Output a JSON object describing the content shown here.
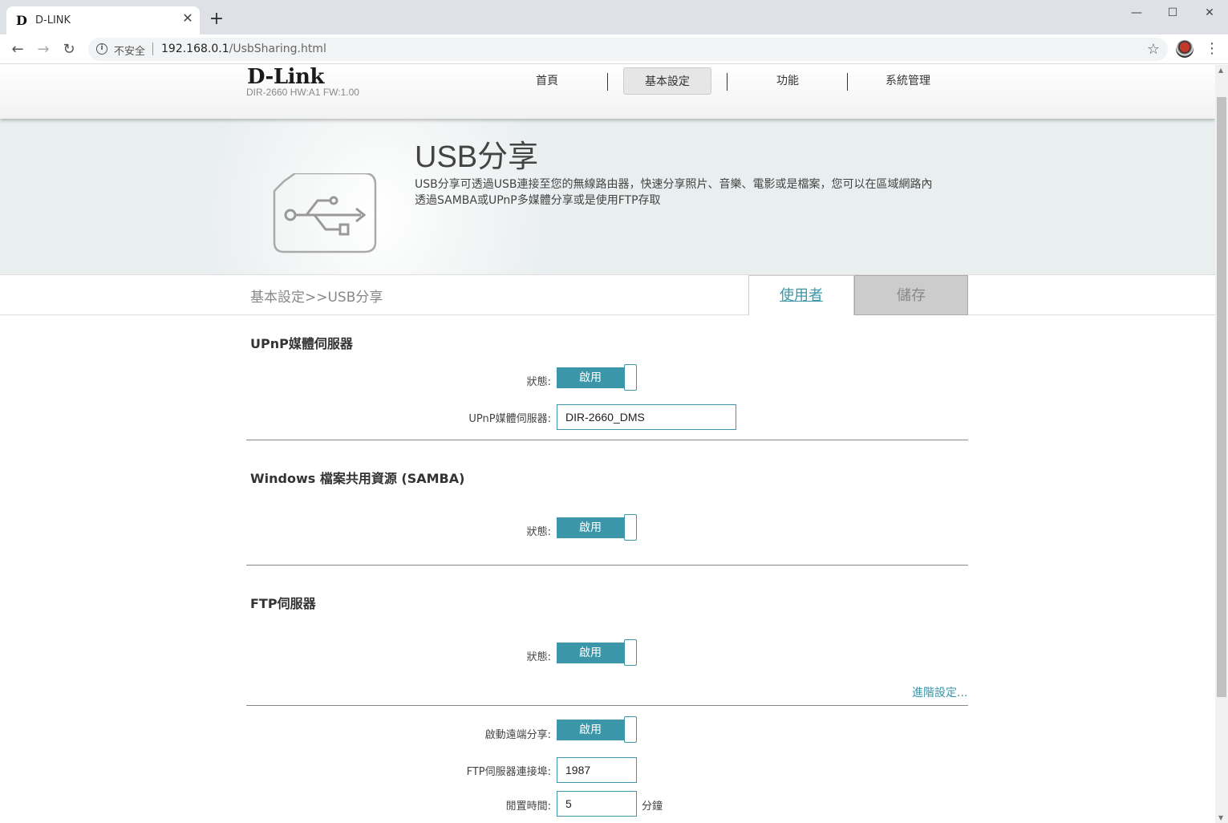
{
  "browser": {
    "tab_title": "D-LINK",
    "tab_favicon": "D",
    "security_label": "不安全",
    "url_host": "192.168.0.1",
    "url_path": "/UsbSharing.html"
  },
  "header": {
    "logo": "D-Link",
    "model": "DIR-2660 HW:A1 FW:1.00",
    "menu": [
      {
        "label": "首頁"
      },
      {
        "label": "基本設定"
      },
      {
        "label": "功能"
      },
      {
        "label": "系統管理"
      }
    ],
    "active_menu": "基本設定"
  },
  "banner": {
    "title": "USB分享",
    "description_line1": "USB分享可透過USB連接至您的無線路由器，快速分享照片、音樂、電影或是檔案，您可以在區域網路內",
    "description_line2": "透過SAMBA或UPnP多媒體分享或是使用FTP存取",
    "icon": "usb-icon"
  },
  "crumbbar": {
    "breadcrumb": "基本設定>>USB分享",
    "user_button": "使用者",
    "save_button": "儲存"
  },
  "upnp": {
    "title": "UPnP媒體伺服器",
    "status_label": "狀態:",
    "status_value": "啟用",
    "server_label": "UPnP媒體伺服器:",
    "server_value": "DIR-2660_DMS"
  },
  "samba": {
    "title": "Windows 檔案共用資源 (SAMBA)",
    "status_label": "狀態:",
    "status_value": "啟用"
  },
  "ftp": {
    "title": "FTP伺服器",
    "status_label": "狀態:",
    "status_value": "啟用",
    "advanced_link": "進階設定...",
    "remote_label": "啟動遠端分享:",
    "remote_value": "啟用",
    "port_label": "FTP伺服器連接埠:",
    "port_value": "1987",
    "idle_label": "閒置時間:",
    "idle_value": "5",
    "idle_unit": "分鐘"
  },
  "colors": {
    "accent": "#3a96a8",
    "save_disabled": "#cccccc",
    "banner_bg": "#e9eeef"
  }
}
